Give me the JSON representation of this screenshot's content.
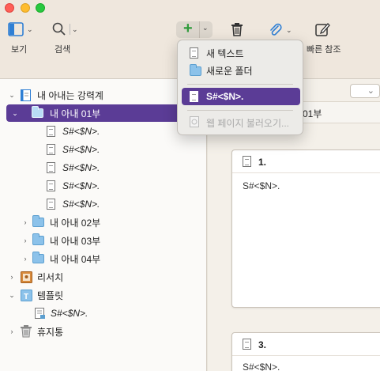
{
  "toolbar": {
    "view_label": "보기",
    "search_label": "검색",
    "quick_ref_label": "빠른 참조"
  },
  "menu": {
    "new_text": "새 텍스트",
    "new_folder": "새로운 폴더",
    "template_item": "S#<$N>.",
    "web_page_import": "웹 페이지 불러오기..."
  },
  "sidebar": {
    "root": "내 아내는 강력계",
    "part1": "내 아내 01부",
    "part1_children": [
      "S#<$N>.",
      "S#<$N>.",
      "S#<$N>.",
      "S#<$N>.",
      "S#<$N>."
    ],
    "part2": "내 아내 02부",
    "part3": "내 아내 03부",
    "part4": "내 아내 04부",
    "research": "리서치",
    "templates": "템플릿",
    "template_doc": "S#<$N>.",
    "trash": "휴지통"
  },
  "editor": {
    "header_title": "01부",
    "cards": [
      {
        "title": "1.",
        "body": "S#<$N>."
      },
      {
        "title": "3.",
        "body": "S#<$N>."
      }
    ]
  },
  "colors": {
    "selection": "#5b3c96",
    "folder": "#8cc2ea",
    "add_icon": "#2e9b3a"
  }
}
